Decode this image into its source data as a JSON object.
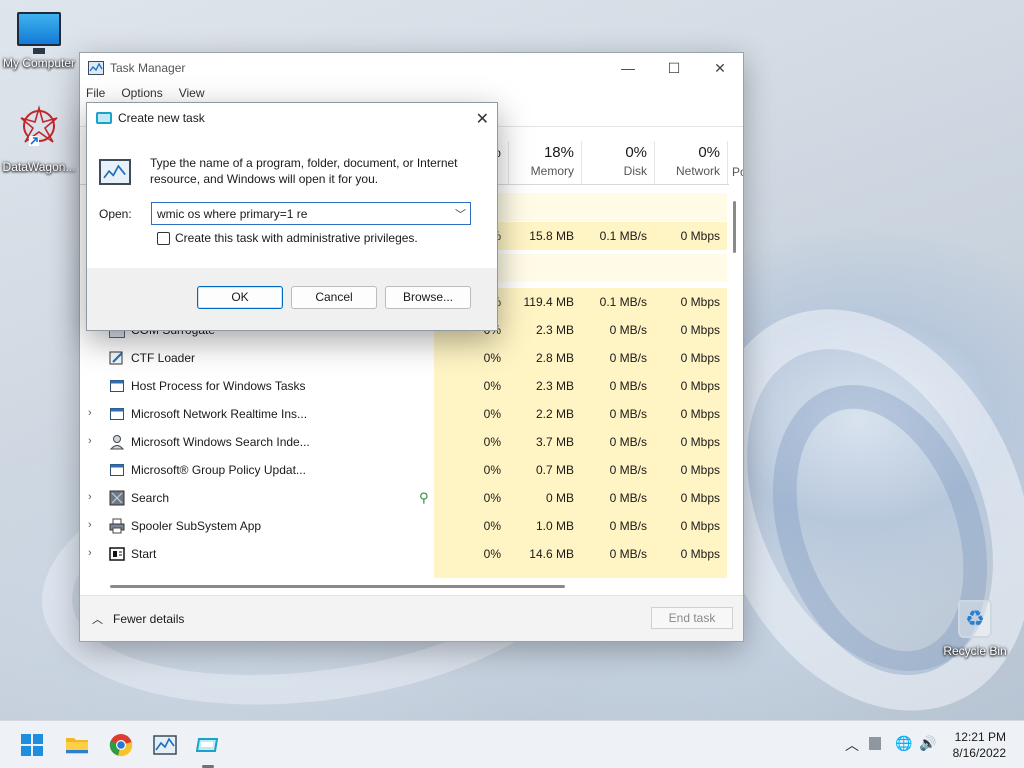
{
  "desktop": {
    "icons": [
      {
        "label": "My Computer"
      },
      {
        "label": "DataWagon..."
      },
      {
        "label": "Recycle Bin"
      }
    ]
  },
  "task_manager": {
    "title": "Task Manager",
    "menu": [
      "File",
      "Options",
      "View"
    ],
    "columns": [
      {
        "pct": "18%",
        "label": "Memory"
      },
      {
        "pct": "0%",
        "label": "Disk"
      },
      {
        "pct": "0%",
        "label": "Network"
      },
      {
        "pct": "",
        "label": "Po"
      }
    ],
    "cpu_partial": "%",
    "rows": [
      {
        "name": "",
        "cpu": "%",
        "memory": "15.8 MB",
        "disk": "0.1 MB/s",
        "network": "0 Mbps"
      },
      {
        "name": "",
        "cpu": "%",
        "memory": "119.4 MB",
        "disk": "0.1 MB/s",
        "network": "0 Mbps"
      },
      {
        "name": "COM Surrogate",
        "cpu": "0%",
        "memory": "2.3 MB",
        "disk": "0 MB/s",
        "network": "0 Mbps"
      },
      {
        "name": "CTF Loader",
        "cpu": "0%",
        "memory": "2.8 MB",
        "disk": "0 MB/s",
        "network": "0 Mbps"
      },
      {
        "name": "Host Process for Windows Tasks",
        "cpu": "0%",
        "memory": "2.3 MB",
        "disk": "0 MB/s",
        "network": "0 Mbps"
      },
      {
        "name": "Microsoft Network Realtime Ins...",
        "cpu": "0%",
        "memory": "2.2 MB",
        "disk": "0 MB/s",
        "network": "0 Mbps"
      },
      {
        "name": "Microsoft Windows Search Inde...",
        "cpu": "0%",
        "memory": "3.7 MB",
        "disk": "0 MB/s",
        "network": "0 Mbps"
      },
      {
        "name": "Microsoft® Group Policy Updat...",
        "cpu": "0%",
        "memory": "0.7 MB",
        "disk": "0 MB/s",
        "network": "0 Mbps"
      },
      {
        "name": "Search",
        "cpu": "0%",
        "memory": "0 MB",
        "disk": "0 MB/s",
        "network": "0 Mbps"
      },
      {
        "name": "Spooler SubSystem App",
        "cpu": "0%",
        "memory": "1.0 MB",
        "disk": "0 MB/s",
        "network": "0 Mbps"
      },
      {
        "name": "Start",
        "cpu": "0%",
        "memory": "14.6 MB",
        "disk": "0 MB/s",
        "network": "0 Mbps"
      }
    ],
    "footer": {
      "fewer_details": "Fewer details",
      "end_task": "End task"
    }
  },
  "dialog": {
    "title": "Create new task",
    "description": "Type the name of a program, folder, document, or Internet resource, and Windows will open it for you.",
    "open_label": "Open:",
    "open_value": "wmic os where primary=1 re",
    "admin_checkbox": "Create this task with administrative privileges.",
    "ok": "OK",
    "cancel": "Cancel",
    "browse": "Browse..."
  },
  "taskbar": {
    "time": "12:21 PM",
    "date": "8/16/2022"
  }
}
